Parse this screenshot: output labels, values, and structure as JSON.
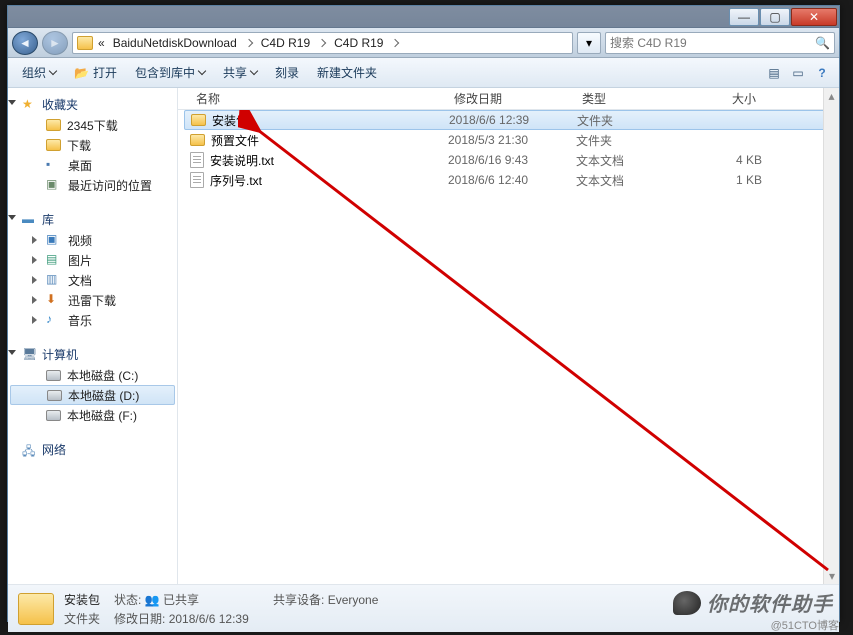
{
  "titlebar": {
    "min": "—",
    "max": "▢",
    "close": "✕"
  },
  "address": {
    "back": "◄",
    "fwd": "►",
    "crumbs": [
      "«",
      "BaiduNetdiskDownload",
      "C4D  R19",
      "C4D R19"
    ],
    "refresh": "↻",
    "search_placeholder": "搜索 C4D R19"
  },
  "toolbar": {
    "organize": "组织",
    "open": "打开",
    "include": "包含到库中",
    "share": "共享",
    "burn": "刻录",
    "newfolder": "新建文件夹",
    "view": "▤",
    "preview": "▭",
    "help": "?"
  },
  "columns": {
    "name": "名称",
    "date": "修改日期",
    "type": "类型",
    "size": "大小"
  },
  "rows": [
    {
      "name": "安装包",
      "date": "2018/6/6 12:39",
      "type": "文件夹",
      "size": "",
      "icon": "folder",
      "selected": true
    },
    {
      "name": "预置文件",
      "date": "2018/5/3 21:30",
      "type": "文件夹",
      "size": "",
      "icon": "folder",
      "selected": false
    },
    {
      "name": "安装说明.txt",
      "date": "2018/6/16 9:43",
      "type": "文本文档",
      "size": "4 KB",
      "icon": "txt",
      "selected": false
    },
    {
      "name": "序列号.txt",
      "date": "2018/6/6 12:40",
      "type": "文本文档",
      "size": "1 KB",
      "icon": "txt",
      "selected": false
    }
  ],
  "nav": {
    "favorites": {
      "label": "收藏夹",
      "items": [
        {
          "label": "2345下载",
          "icon": "folder"
        },
        {
          "label": "下载",
          "icon": "folder"
        },
        {
          "label": "桌面",
          "icon": "desktop"
        },
        {
          "label": "最近访问的位置",
          "icon": "recent"
        }
      ]
    },
    "libraries": {
      "label": "库",
      "items": [
        {
          "label": "视频",
          "icon": "video"
        },
        {
          "label": "图片",
          "icon": "pic"
        },
        {
          "label": "文档",
          "icon": "doc"
        },
        {
          "label": "迅雷下载",
          "icon": "thunder"
        },
        {
          "label": "音乐",
          "icon": "music"
        }
      ]
    },
    "computer": {
      "label": "计算机",
      "items": [
        {
          "label": "本地磁盘 (C:)",
          "icon": "drive"
        },
        {
          "label": "本地磁盘 (D:)",
          "icon": "drive",
          "selected": true
        },
        {
          "label": "本地磁盘 (F:)",
          "icon": "drive"
        }
      ]
    },
    "network": {
      "label": "网络"
    }
  },
  "details": {
    "name": "安装包",
    "state_label": "状态:",
    "state_value": "已共享",
    "type_label": "文件夹",
    "date_label": "修改日期:",
    "date_value": "2018/6/6 12:39",
    "share_label": "共享设备:",
    "share_value": "Everyone"
  },
  "watermark": {
    "text": "你的软件助手",
    "sub": "@51CTO博客"
  }
}
